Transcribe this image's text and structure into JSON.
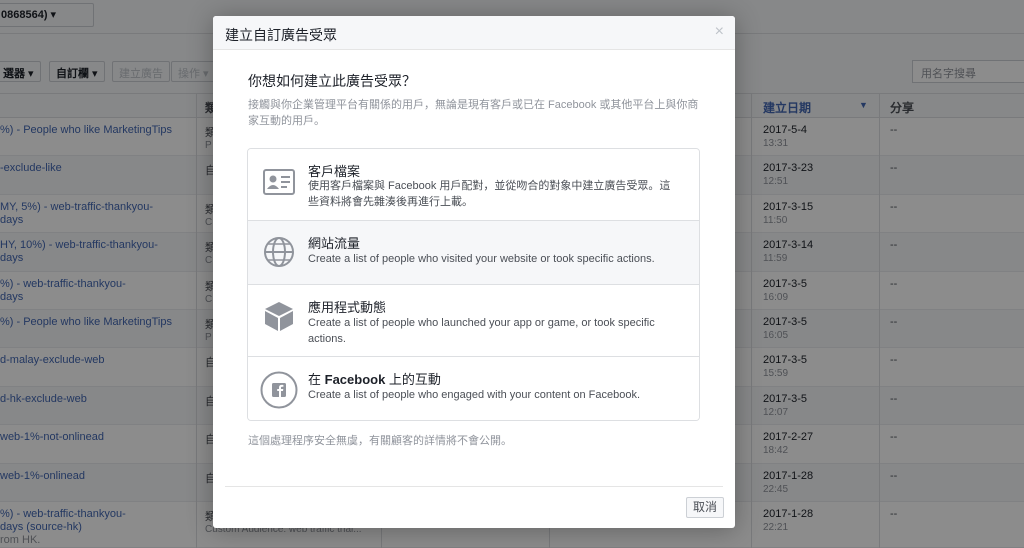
{
  "background": {
    "account_label": "0868564)",
    "toolbar": {
      "filter_label": "選器",
      "columns_label": "自訂欄",
      "create_ad_label": "建立廣告",
      "actions_label": "操作"
    },
    "search_placeholder": "用名字搜尋",
    "headers": {
      "type": "類",
      "created": "建立日期",
      "share": "分享"
    },
    "rows": [
      {
        "name": "%) - People who like MarketingTips",
        "sub": "",
        "type": "類",
        "type_sub": "P",
        "date": "2017-5-4",
        "time": "13:31",
        "share": "--"
      },
      {
        "name": "-exclude-like",
        "sub": "",
        "type": "自",
        "type_sub": "",
        "date": "2017-3-23",
        "time": "12:51",
        "share": "--"
      },
      {
        "name": "MY, 5%) - web-traffic-thankyou-",
        "sub": "days",
        "type": "類",
        "type_sub": "C",
        "date": "2017-3-15",
        "time": "11:50",
        "share": "--"
      },
      {
        "name": "HY, 10%) - web-traffic-thankyou-",
        "sub": "days",
        "type": "類",
        "type_sub": "C",
        "date": "2017-3-14",
        "time": "11:59",
        "share": "--"
      },
      {
        "name": "%) - web-traffic-thankyou-",
        "sub": "days",
        "type": "類",
        "type_sub": "C",
        "date": "2017-3-5",
        "time": "16:09",
        "share": "--"
      },
      {
        "name": "%) - People who like MarketingTips",
        "sub": "",
        "type": "類",
        "type_sub": "P",
        "date": "2017-3-5",
        "time": "16:05",
        "share": "--"
      },
      {
        "name": "d-malay-exclude-web",
        "sub": "",
        "type": "自",
        "type_sub": "",
        "date": "2017-3-5",
        "time": "15:59",
        "share": "--"
      },
      {
        "name": "d-hk-exclude-web",
        "sub": "",
        "type": "自",
        "type_sub": "",
        "date": "2017-3-5",
        "time": "12:07",
        "share": "--"
      },
      {
        "name": "web-1%-not-onlinead",
        "sub": "",
        "type": "自",
        "type_sub": "",
        "date": "2017-2-27",
        "time": "18:42",
        "share": "--"
      },
      {
        "name": "web-1%-onlinead",
        "sub": "",
        "type": "自",
        "type_sub": "",
        "date": "2017-1-28",
        "time": "22:45",
        "share": "--"
      },
      {
        "name": "%) - web-traffic-thankyou-",
        "sub": "days (source-hk)",
        "sub2": "rom HK.",
        "type": "類",
        "type_sub": "Custom Audience: web traffic thai...",
        "date": "2017-1-28",
        "time": "22:21",
        "share": "--"
      }
    ]
  },
  "modal": {
    "title": "建立自訂廣告受眾",
    "close_symbol": "×",
    "question": "你想如何建立此廣告受眾？",
    "description": "接觸與你企業管理平台有關係的用戶，無論是現有客戶或已在 Facebook 或其他平台上與你商家互動的用戶。",
    "options": [
      {
        "icon": "contact-card-icon",
        "title": "客戶檔案",
        "desc": "使用客戶檔案與 Facebook 用戶配對，並從吻合的對象中建立廣告受眾。這些資料將會先雜湊後再進行上載。"
      },
      {
        "icon": "globe-icon",
        "title": "網站流量",
        "desc": "Create a list of people who visited your website or took specific actions."
      },
      {
        "icon": "cube-icon",
        "title": "應用程式動態",
        "desc": "Create a list of people who launched your app or game, or took specific actions."
      },
      {
        "icon": "facebook-icon",
        "title_prefix": "在 ",
        "title_bold": "Facebook",
        "title_suffix": " 上的互動",
        "desc": "Create a list of people who engaged with your content on Facebook."
      }
    ],
    "footnote": "這個處理程序安全無虞，有關顧客的詳情將不會公開。",
    "cancel_label": "取消"
  },
  "colors": {
    "link_blue": "#4267b2",
    "overlay": "rgba(0,0,0,0.45)",
    "icon_gray": "#90949c"
  }
}
